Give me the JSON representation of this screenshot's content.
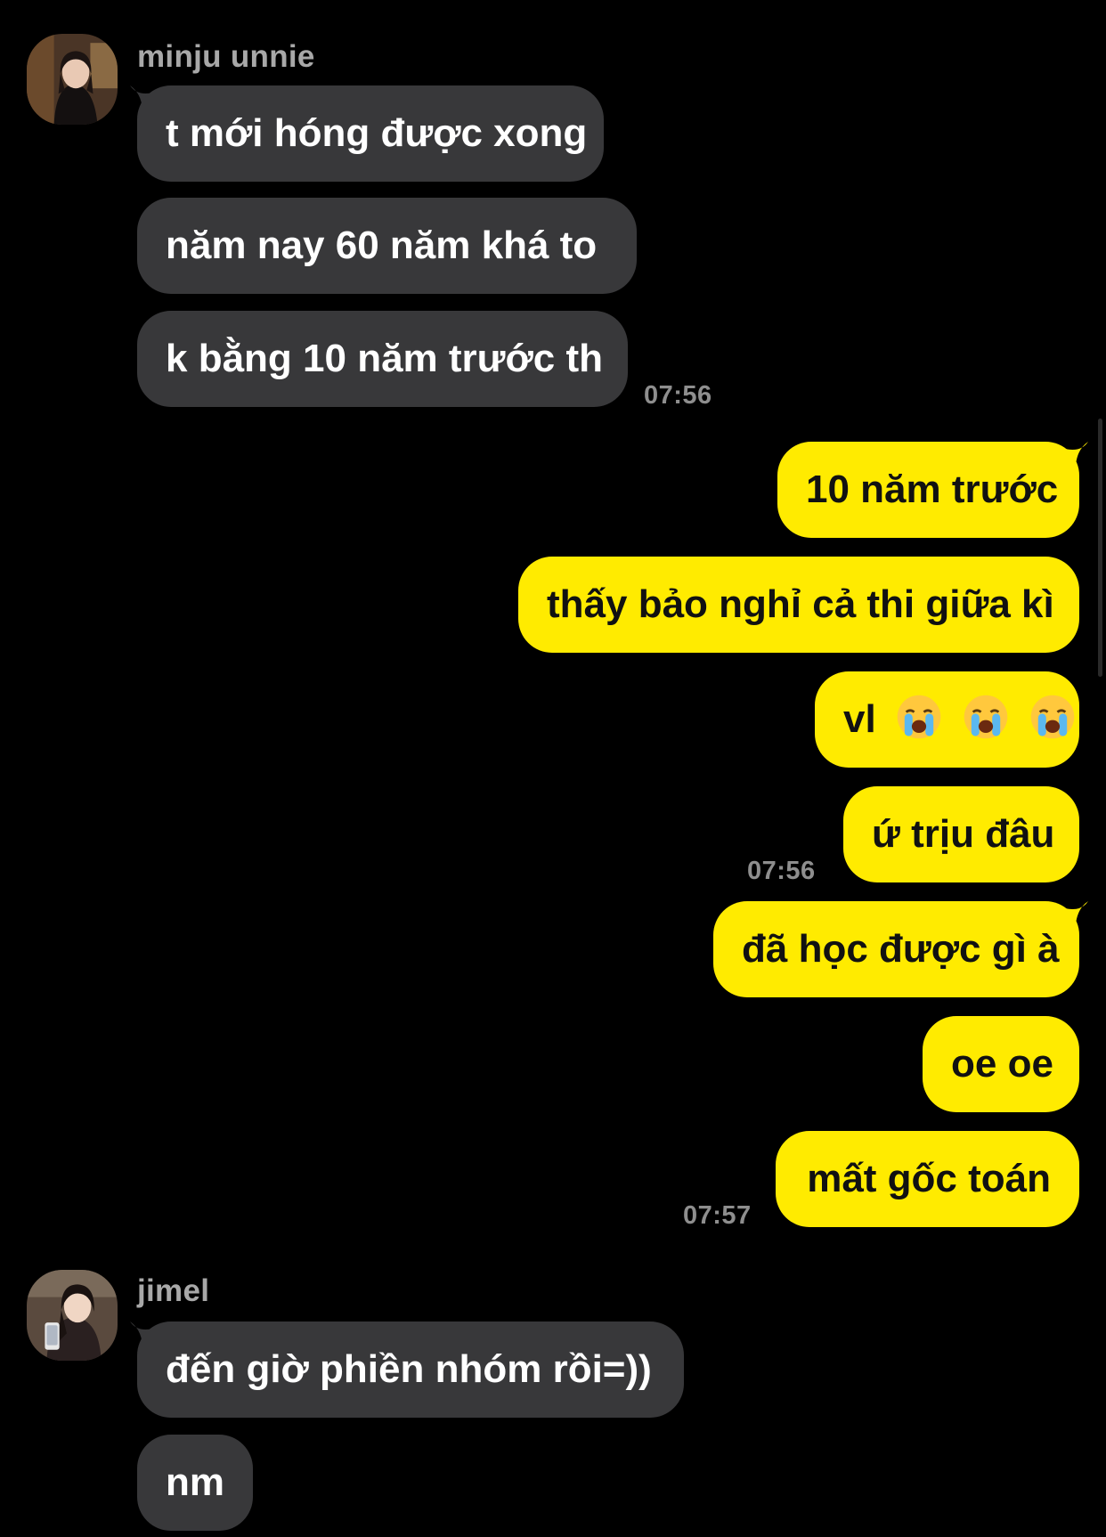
{
  "groups": [
    {
      "sender": "minju unnie",
      "avatar_icon": "profile-photo-icon",
      "messages": [
        "t mới hóng được xong",
        "năm nay 60 năm khá to",
        "k bằng 10 năm trước th"
      ],
      "time": "07:56"
    },
    {
      "own": true,
      "messages": [
        "10 năm trước",
        "thấy bảo nghỉ cả thi giữa kì",
        "vl",
        "ứ trịu đâu"
      ],
      "emoji": "loudly-crying-face-icon",
      "time": "07:56"
    },
    {
      "own": true,
      "messages": [
        "đã học được gì à",
        "oe oe",
        "mất gốc toán"
      ],
      "time": "07:57"
    },
    {
      "sender": "jimel",
      "avatar_icon": "profile-photo-icon",
      "messages": [
        "đến giờ phiền nhóm rồi=))",
        "nm"
      ]
    }
  ],
  "colors": {
    "background": "#000000",
    "incoming_bubble": "#38383a",
    "outgoing_bubble": "#ffeb00",
    "sender_text": "#a8a8a8",
    "timestamp_text": "#8e8e8e"
  }
}
